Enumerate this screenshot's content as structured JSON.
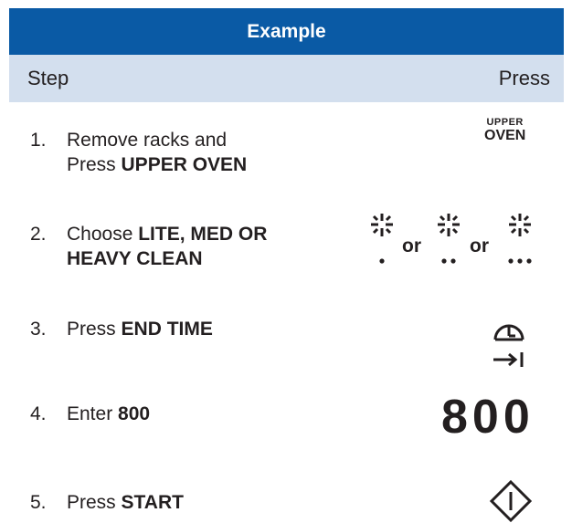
{
  "header": {
    "title": "Example"
  },
  "columns": {
    "step": "Step",
    "press": "Press"
  },
  "steps": [
    {
      "num": "1.",
      "text_a": "Remove racks and",
      "text_b": "Press ",
      "bold": "UPPER OVEN"
    },
    {
      "num": "2.",
      "text_a": "Choose ",
      "bold_a": "LITE, MED OR",
      "bold_b": "HEAVY CLEAN"
    },
    {
      "num": "3.",
      "text_a": "Press ",
      "bold": "END TIME"
    },
    {
      "num": "4.",
      "text_a": "Enter ",
      "bold": "800"
    },
    {
      "num": "5.",
      "text_a": "Press ",
      "bold": "START"
    }
  ],
  "keys": {
    "upper_oven_line1": "UPPER",
    "upper_oven_line2": "OVEN",
    "or_label": "or",
    "display_800": "800"
  },
  "icons": {
    "clean_levels": [
      "clean-lite-icon",
      "clean-med-icon",
      "clean-heavy-icon"
    ],
    "end_time": "end-time-icon",
    "start": "start-icon"
  },
  "colors": {
    "header_bg": "#0a5aa5",
    "subheader_bg": "#d3dfee",
    "text": "#231f20"
  }
}
